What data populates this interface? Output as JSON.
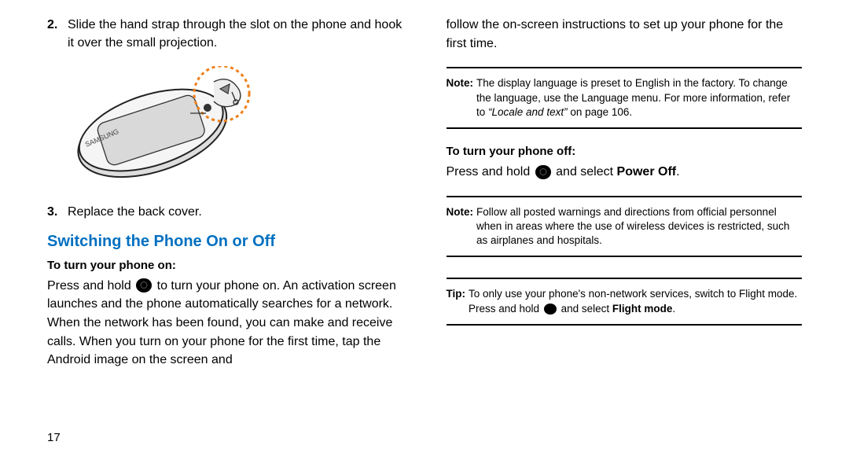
{
  "left": {
    "step2_num": "2.",
    "step2_text": "Slide the hand strap through the slot on the phone and hook it over the small projection.",
    "step3_num": "3.",
    "step3_text": "Replace the back cover.",
    "section_heading": "Switching the Phone On or Off",
    "sub_on": "To turn your phone on:",
    "body_on_before": "Press and hold ",
    "body_on_after": " to turn your phone on. An activation screen launches and the phone automatically searches for a network. When the network has been found, you can make and receive calls. When you turn on your phone for the first time, tap the Android image on the screen and",
    "page_number": "17"
  },
  "right": {
    "cont_text": "follow the on-screen instructions to set up your phone for the first time.",
    "note1_label": "Note:",
    "note1_text_before": "The display language is preset to English in the factory. To change the language, use the Language menu. For more information, refer to ",
    "note1_italic": "“Locale and text”",
    "note1_text_after": "  on page 106.",
    "sub_off": "To turn your phone off:",
    "off_before": "Press and hold ",
    "off_after_1": " and select ",
    "off_power": "Power Off",
    "off_dot": ".",
    "note2_label": "Note:",
    "note2_text": "Follow all posted warnings and directions from official personnel when in areas where the use of wireless devices is restricted, such as airplanes and hospitals.",
    "tip_label": "Tip:",
    "tip_before": "To only use your phone's non-network services, switch to Flight mode. Press and hold ",
    "tip_after_1": " and select ",
    "tip_flight": "Flight mode",
    "tip_dot": "."
  }
}
